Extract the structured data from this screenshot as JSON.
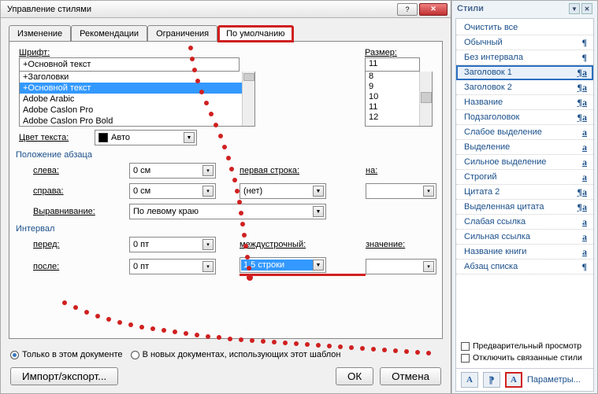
{
  "dialog": {
    "title": "Управление стилями",
    "help_glyph": "?",
    "close_glyph": "✕",
    "tabs": [
      "Изменение",
      "Рекомендации",
      "Ограничения",
      "По умолчанию"
    ],
    "active_tab": 3,
    "font_label": "Шрифт:",
    "font_value": "+Основной текст",
    "font_list": [
      "+Заголовки",
      "+Основной текст",
      "Adobe Arabic",
      "Adobe Caslon Pro",
      "Adobe Caslon Pro Bold"
    ],
    "font_selected_index": 1,
    "size_label": "Размер:",
    "size_value": "11",
    "size_list": [
      "8",
      "9",
      "10",
      "11",
      "12"
    ],
    "size_selected_index": 3,
    "color_label": "Цвет текста:",
    "color_value": "Авто",
    "para_group": "Положение абзаца",
    "left_label": "слева:",
    "left_value": "0 см",
    "right_label": "справа:",
    "right_value": "0 см",
    "firstline_label": "первая строка:",
    "firstline_value": "(нет)",
    "on_label": "на:",
    "on_value": "",
    "align_label": "Выравнивание:",
    "align_value": "По левому краю",
    "spacing_group": "Интервал",
    "before_label": "перед:",
    "before_value": "0 пт",
    "after_label": "после:",
    "after_value": "0 пт",
    "linesp_label": "междустрочный:",
    "linesp_value": "1,5 строки",
    "value_label": "значение:",
    "value_value": "",
    "radio_this": "Только в этом документе",
    "radio_new": "В новых документах, использующих этот шаблон",
    "import_btn": "Импорт/экспорт...",
    "ok_btn": "ОК",
    "cancel_btn": "Отмена"
  },
  "panel": {
    "title": "Стили",
    "styles": [
      {
        "name": "Очистить все",
        "glyph": ""
      },
      {
        "name": "Обычный",
        "glyph": "¶"
      },
      {
        "name": "Без интервала",
        "glyph": "¶"
      },
      {
        "name": "Заголовок 1",
        "glyph": "¶a",
        "sel": true
      },
      {
        "name": "Заголовок 2",
        "glyph": "¶a"
      },
      {
        "name": "Название",
        "glyph": "¶a"
      },
      {
        "name": "Подзаголовок",
        "glyph": "¶a"
      },
      {
        "name": "Слабое выделение",
        "glyph": "a"
      },
      {
        "name": "Выделение",
        "glyph": "a"
      },
      {
        "name": "Сильное выделение",
        "glyph": "a"
      },
      {
        "name": "Строгий",
        "glyph": "a"
      },
      {
        "name": "Цитата 2",
        "glyph": "¶a"
      },
      {
        "name": "Выделенная цитата",
        "glyph": "¶a"
      },
      {
        "name": "Слабая ссылка",
        "glyph": "a"
      },
      {
        "name": "Сильная ссылка",
        "glyph": "a"
      },
      {
        "name": "Название книги",
        "glyph": "a"
      },
      {
        "name": "Абзац списка",
        "glyph": "¶"
      }
    ],
    "chk_preview": "Предварительный просмотр",
    "chk_disable": "Отключить связанные стили",
    "options": "Параметры..."
  }
}
